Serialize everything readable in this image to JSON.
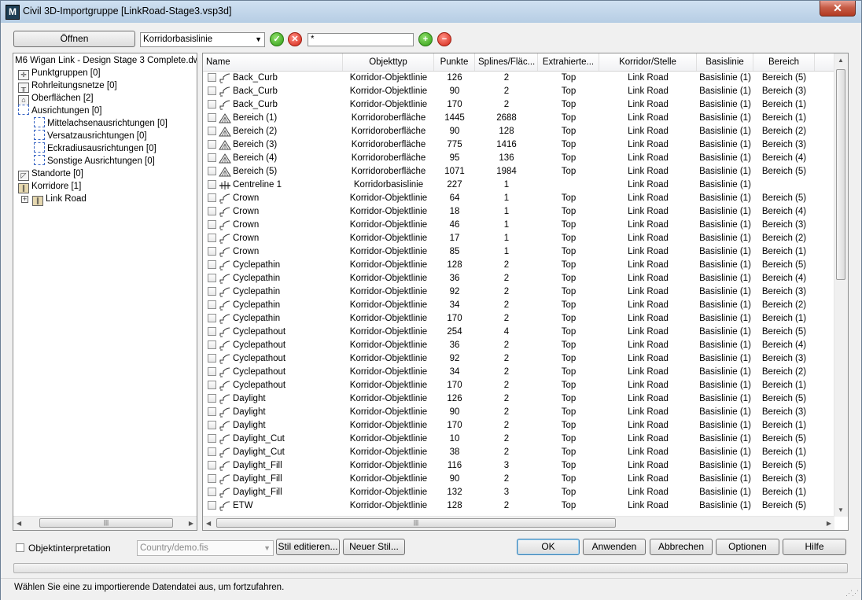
{
  "window": {
    "title": "Civil 3D-Importgruppe [LinkRoad-Stage3.vsp3d]",
    "app_icon_letter": "M",
    "close_glyph": "✕"
  },
  "toolbar": {
    "open_label": "Öffnen",
    "type_filter_value": "Korridorbasislinie",
    "confirm_glyph": "✓",
    "cancel_glyph": "✕",
    "search_value": "*",
    "add_glyph": "+",
    "remove_glyph": "−"
  },
  "tree": {
    "root": "M6 Wigan Link - Design Stage 3 Complete.dwg",
    "items": [
      {
        "label": "Punktgruppen [0]",
        "icon": "point-groups-icon"
      },
      {
        "label": "Rohrleitungsnetze [0]",
        "icon": "pipe-networks-icon"
      },
      {
        "label": "Oberflächen [2]",
        "icon": "surfaces-icon"
      },
      {
        "label": "Ausrichtungen [0]",
        "icon": "alignments-icon"
      },
      {
        "label": "Mittelachsenausrichtungen [0]",
        "icon": "centerline-alignment-icon"
      },
      {
        "label": "Versatzausrichtungen [0]",
        "icon": "offset-alignment-icon"
      },
      {
        "label": "Eckradiusausrichtungen [0]",
        "icon": "curb-return-alignment-icon"
      },
      {
        "label": "Sonstige Ausrichtungen [0]",
        "icon": "other-alignment-icon"
      },
      {
        "label": "Standorte [0]",
        "icon": "sites-icon"
      },
      {
        "label": "Korridore [1]",
        "icon": "corridors-icon"
      },
      {
        "label": "Link Road",
        "icon": "corridor-icon"
      }
    ]
  },
  "grid": {
    "columns": [
      "Name",
      "Objekttyp",
      "Punkte",
      "Splines/Fläc...",
      "Extrahierte...",
      "Korridor/Stelle",
      "Basislinie",
      "Bereich"
    ],
    "rows": [
      [
        "Back_Curb",
        "Korridor-Objektlinie",
        "126",
        "2",
        "Top",
        "Link Road",
        "Basislinie (1)",
        "Bereich (5)"
      ],
      [
        "Back_Curb",
        "Korridor-Objektlinie",
        "90",
        "2",
        "Top",
        "Link Road",
        "Basislinie (1)",
        "Bereich (3)"
      ],
      [
        "Back_Curb",
        "Korridor-Objektlinie",
        "170",
        "2",
        "Top",
        "Link Road",
        "Basislinie (1)",
        "Bereich (1)"
      ],
      [
        "Bereich (1)",
        "Korridoroberfläche",
        "1445",
        "2688",
        "Top",
        "Link Road",
        "Basislinie (1)",
        "Bereich (1)"
      ],
      [
        "Bereich (2)",
        "Korridoroberfläche",
        "90",
        "128",
        "Top",
        "Link Road",
        "Basislinie (1)",
        "Bereich (2)"
      ],
      [
        "Bereich (3)",
        "Korridoroberfläche",
        "775",
        "1416",
        "Top",
        "Link Road",
        "Basislinie (1)",
        "Bereich (3)"
      ],
      [
        "Bereich (4)",
        "Korridoroberfläche",
        "95",
        "136",
        "Top",
        "Link Road",
        "Basislinie (1)",
        "Bereich (4)"
      ],
      [
        "Bereich (5)",
        "Korridoroberfläche",
        "1071",
        "1984",
        "Top",
        "Link Road",
        "Basislinie (1)",
        "Bereich (5)"
      ],
      [
        "Centreline 1",
        "Korridorbasislinie",
        "227",
        "1",
        "",
        "Link Road",
        "Basislinie (1)",
        ""
      ],
      [
        "Crown",
        "Korridor-Objektlinie",
        "64",
        "1",
        "Top",
        "Link Road",
        "Basislinie (1)",
        "Bereich (5)"
      ],
      [
        "Crown",
        "Korridor-Objektlinie",
        "18",
        "1",
        "Top",
        "Link Road",
        "Basislinie (1)",
        "Bereich (4)"
      ],
      [
        "Crown",
        "Korridor-Objektlinie",
        "46",
        "1",
        "Top",
        "Link Road",
        "Basislinie (1)",
        "Bereich (3)"
      ],
      [
        "Crown",
        "Korridor-Objektlinie",
        "17",
        "1",
        "Top",
        "Link Road",
        "Basislinie (1)",
        "Bereich (2)"
      ],
      [
        "Crown",
        "Korridor-Objektlinie",
        "85",
        "1",
        "Top",
        "Link Road",
        "Basislinie (1)",
        "Bereich (1)"
      ],
      [
        "Cyclepathin",
        "Korridor-Objektlinie",
        "128",
        "2",
        "Top",
        "Link Road",
        "Basislinie (1)",
        "Bereich (5)"
      ],
      [
        "Cyclepathin",
        "Korridor-Objektlinie",
        "36",
        "2",
        "Top",
        "Link Road",
        "Basislinie (1)",
        "Bereich (4)"
      ],
      [
        "Cyclepathin",
        "Korridor-Objektlinie",
        "92",
        "2",
        "Top",
        "Link Road",
        "Basislinie (1)",
        "Bereich (3)"
      ],
      [
        "Cyclepathin",
        "Korridor-Objektlinie",
        "34",
        "2",
        "Top",
        "Link Road",
        "Basislinie (1)",
        "Bereich (2)"
      ],
      [
        "Cyclepathin",
        "Korridor-Objektlinie",
        "170",
        "2",
        "Top",
        "Link Road",
        "Basislinie (1)",
        "Bereich (1)"
      ],
      [
        "Cyclepathout",
        "Korridor-Objektlinie",
        "254",
        "4",
        "Top",
        "Link Road",
        "Basislinie (1)",
        "Bereich (5)"
      ],
      [
        "Cyclepathout",
        "Korridor-Objektlinie",
        "36",
        "2",
        "Top",
        "Link Road",
        "Basislinie (1)",
        "Bereich (4)"
      ],
      [
        "Cyclepathout",
        "Korridor-Objektlinie",
        "92",
        "2",
        "Top",
        "Link Road",
        "Basislinie (1)",
        "Bereich (3)"
      ],
      [
        "Cyclepathout",
        "Korridor-Objektlinie",
        "34",
        "2",
        "Top",
        "Link Road",
        "Basislinie (1)",
        "Bereich (2)"
      ],
      [
        "Cyclepathout",
        "Korridor-Objektlinie",
        "170",
        "2",
        "Top",
        "Link Road",
        "Basislinie (1)",
        "Bereich (1)"
      ],
      [
        "Daylight",
        "Korridor-Objektlinie",
        "126",
        "2",
        "Top",
        "Link Road",
        "Basislinie (1)",
        "Bereich (5)"
      ],
      [
        "Daylight",
        "Korridor-Objektlinie",
        "90",
        "2",
        "Top",
        "Link Road",
        "Basislinie (1)",
        "Bereich (3)"
      ],
      [
        "Daylight",
        "Korridor-Objektlinie",
        "170",
        "2",
        "Top",
        "Link Road",
        "Basislinie (1)",
        "Bereich (1)"
      ],
      [
        "Daylight_Cut",
        "Korridor-Objektlinie",
        "10",
        "2",
        "Top",
        "Link Road",
        "Basislinie (1)",
        "Bereich (5)"
      ],
      [
        "Daylight_Cut",
        "Korridor-Objektlinie",
        "38",
        "2",
        "Top",
        "Link Road",
        "Basislinie (1)",
        "Bereich (1)"
      ],
      [
        "Daylight_Fill",
        "Korridor-Objektlinie",
        "116",
        "3",
        "Top",
        "Link Road",
        "Basislinie (1)",
        "Bereich (5)"
      ],
      [
        "Daylight_Fill",
        "Korridor-Objektlinie",
        "90",
        "2",
        "Top",
        "Link Road",
        "Basislinie (1)",
        "Bereich (3)"
      ],
      [
        "Daylight_Fill",
        "Korridor-Objektlinie",
        "132",
        "3",
        "Top",
        "Link Road",
        "Basislinie (1)",
        "Bereich (1)"
      ],
      [
        "ETW",
        "Korridor-Objektlinie",
        "128",
        "2",
        "Top",
        "Link Road",
        "Basislinie (1)",
        "Bereich (5)"
      ]
    ]
  },
  "footer": {
    "interpret_label": "Objektinterpretation",
    "style_file_value": "Country/demo.fis",
    "edit_style_label": "Stil editieren...",
    "new_style_label": "Neuer Stil...",
    "ok_label": "OK",
    "apply_label": "Anwenden",
    "cancel_label": "Abbrechen",
    "options_label": "Optionen",
    "help_label": "Hilfe"
  },
  "status": {
    "text": "Wählen Sie eine zu importierende Datendatei aus, um fortzufahren."
  }
}
